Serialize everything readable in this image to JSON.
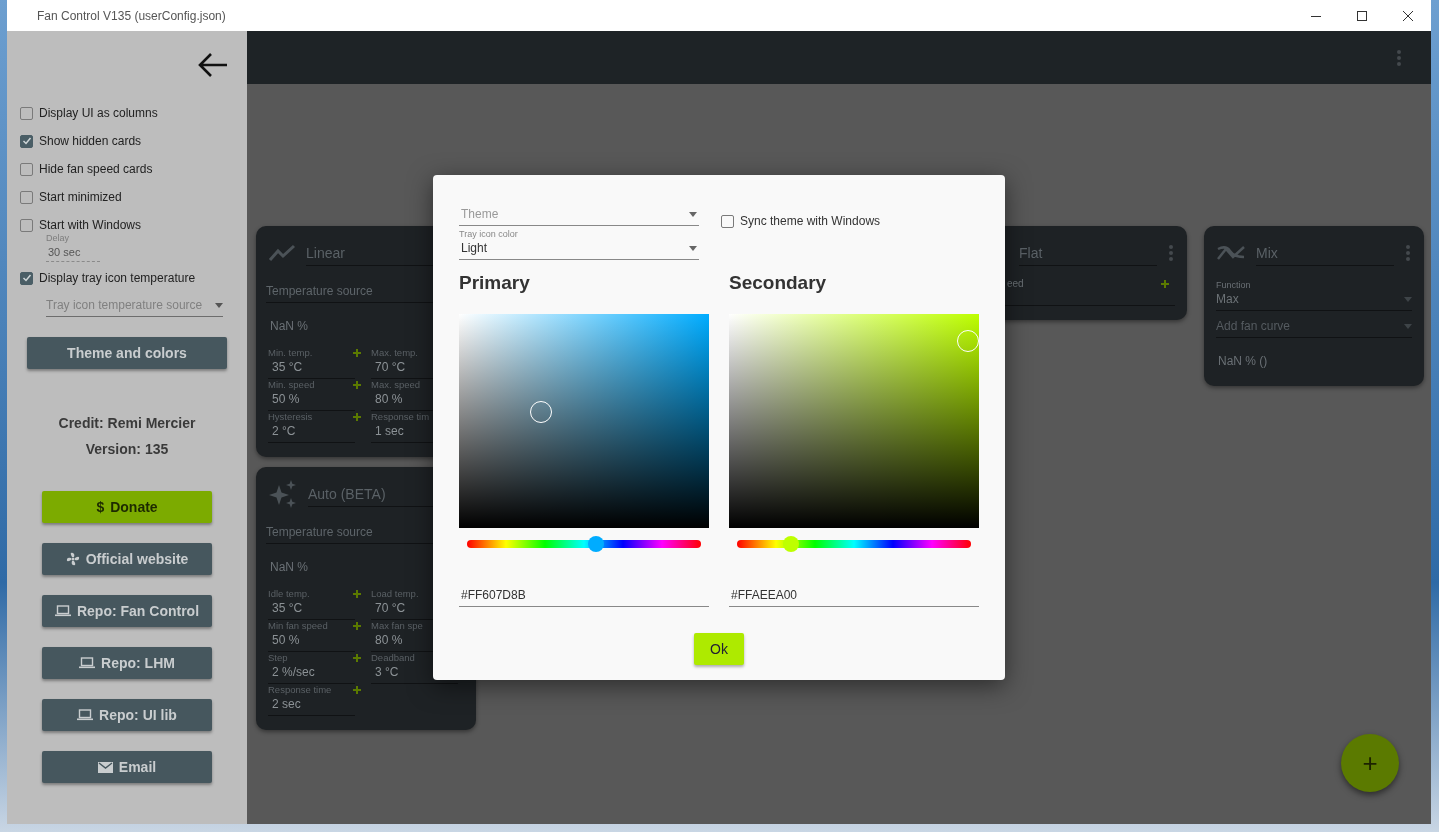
{
  "window": {
    "title": "Fan Control V135 (userConfig.json)"
  },
  "sidebar": {
    "options": [
      {
        "label": "Display UI as columns",
        "checked": false
      },
      {
        "label": "Show hidden cards",
        "checked": true
      },
      {
        "label": "Hide fan speed cards",
        "checked": false
      },
      {
        "label": "Start minimized",
        "checked": false
      },
      {
        "label": "Start with Windows",
        "checked": false,
        "delay": {
          "label": "Delay",
          "value": "30 sec"
        }
      },
      {
        "label": "Display tray icon temperature",
        "checked": true,
        "source": {
          "placeholder": "Tray icon temperature source"
        }
      }
    ],
    "theme_button": "Theme and colors",
    "credit": "Credit: Remi Mercier",
    "version": "Version: 135",
    "links": [
      {
        "label": "Donate",
        "kind": "donate",
        "glyph": "$"
      },
      {
        "label": "Official website",
        "kind": "website"
      },
      {
        "label": "Repo: Fan Control",
        "kind": "repo"
      },
      {
        "label": "Repo: LHM",
        "kind": "repo"
      },
      {
        "label": "Repo: UI lib",
        "kind": "repo"
      },
      {
        "label": "Email",
        "kind": "email"
      }
    ]
  },
  "columns": [
    [
      {
        "kind": "linear",
        "title": "Linear",
        "source": "Temperature source",
        "reading": "NaN %",
        "fields": [
          {
            "label": "Min. temp.",
            "value": "35 °C"
          },
          {
            "label": "Max. temp.",
            "value": "70 °C"
          },
          {
            "label": "Min. speed",
            "value": "50 %"
          },
          {
            "label": "Max. speed",
            "value": "80 %"
          },
          {
            "label": "Hysteresis",
            "value": "2 °C"
          },
          {
            "label": "Response tim",
            "value": "1 sec"
          }
        ]
      },
      {
        "kind": "auto",
        "title": "Auto (BETA)",
        "source": "Temperature source",
        "reading": "NaN %",
        "fields": [
          {
            "label": "Idle temp.",
            "value": "35 °C"
          },
          {
            "label": "Load temp.",
            "value": "70 °C"
          },
          {
            "label": "Min fan speed",
            "value": "50 %"
          },
          {
            "label": "Max fan spe",
            "value": "80 %"
          },
          {
            "label": "Step",
            "value": "2 %/sec"
          },
          {
            "label": "Deadband",
            "value": "3 °C"
          },
          {
            "label": "Response time",
            "value": "2 sec"
          }
        ]
      }
    ],
    [],
    [],
    [
      {
        "kind": "flat",
        "title": "Flat",
        "partial_label": "eed"
      }
    ],
    [
      {
        "kind": "mix",
        "title": "Mix",
        "function": {
          "label": "Function",
          "value": "Max"
        },
        "add_placeholder": "Add fan curve",
        "reading": "NaN % ()"
      }
    ]
  ],
  "dialog": {
    "theme": {
      "placeholder": "Theme"
    },
    "tray_icon_color": {
      "label": "Tray icon color",
      "value": "Light"
    },
    "sync": {
      "label": "Sync theme with Windows",
      "checked": false
    },
    "pickers": [
      {
        "title": "Primary",
        "level": 0.55,
        "hex": "#FF607D8B"
      },
      {
        "title": "Secondary",
        "level": 0.23,
        "hex": "#FFAEEA00"
      }
    ],
    "ok": "Ok"
  },
  "fab": "+"
}
